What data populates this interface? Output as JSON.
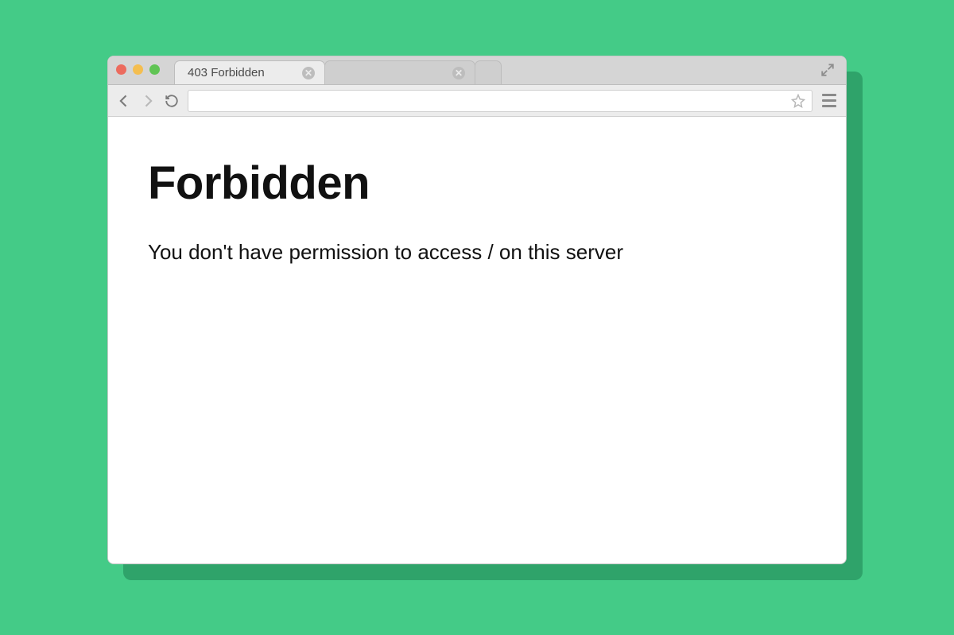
{
  "tabs": {
    "active": {
      "title": "403 Forbidden"
    }
  },
  "urlbar": {
    "value": ""
  },
  "content": {
    "heading": "Forbidden",
    "message": "You don't have permission to access / on this server"
  }
}
